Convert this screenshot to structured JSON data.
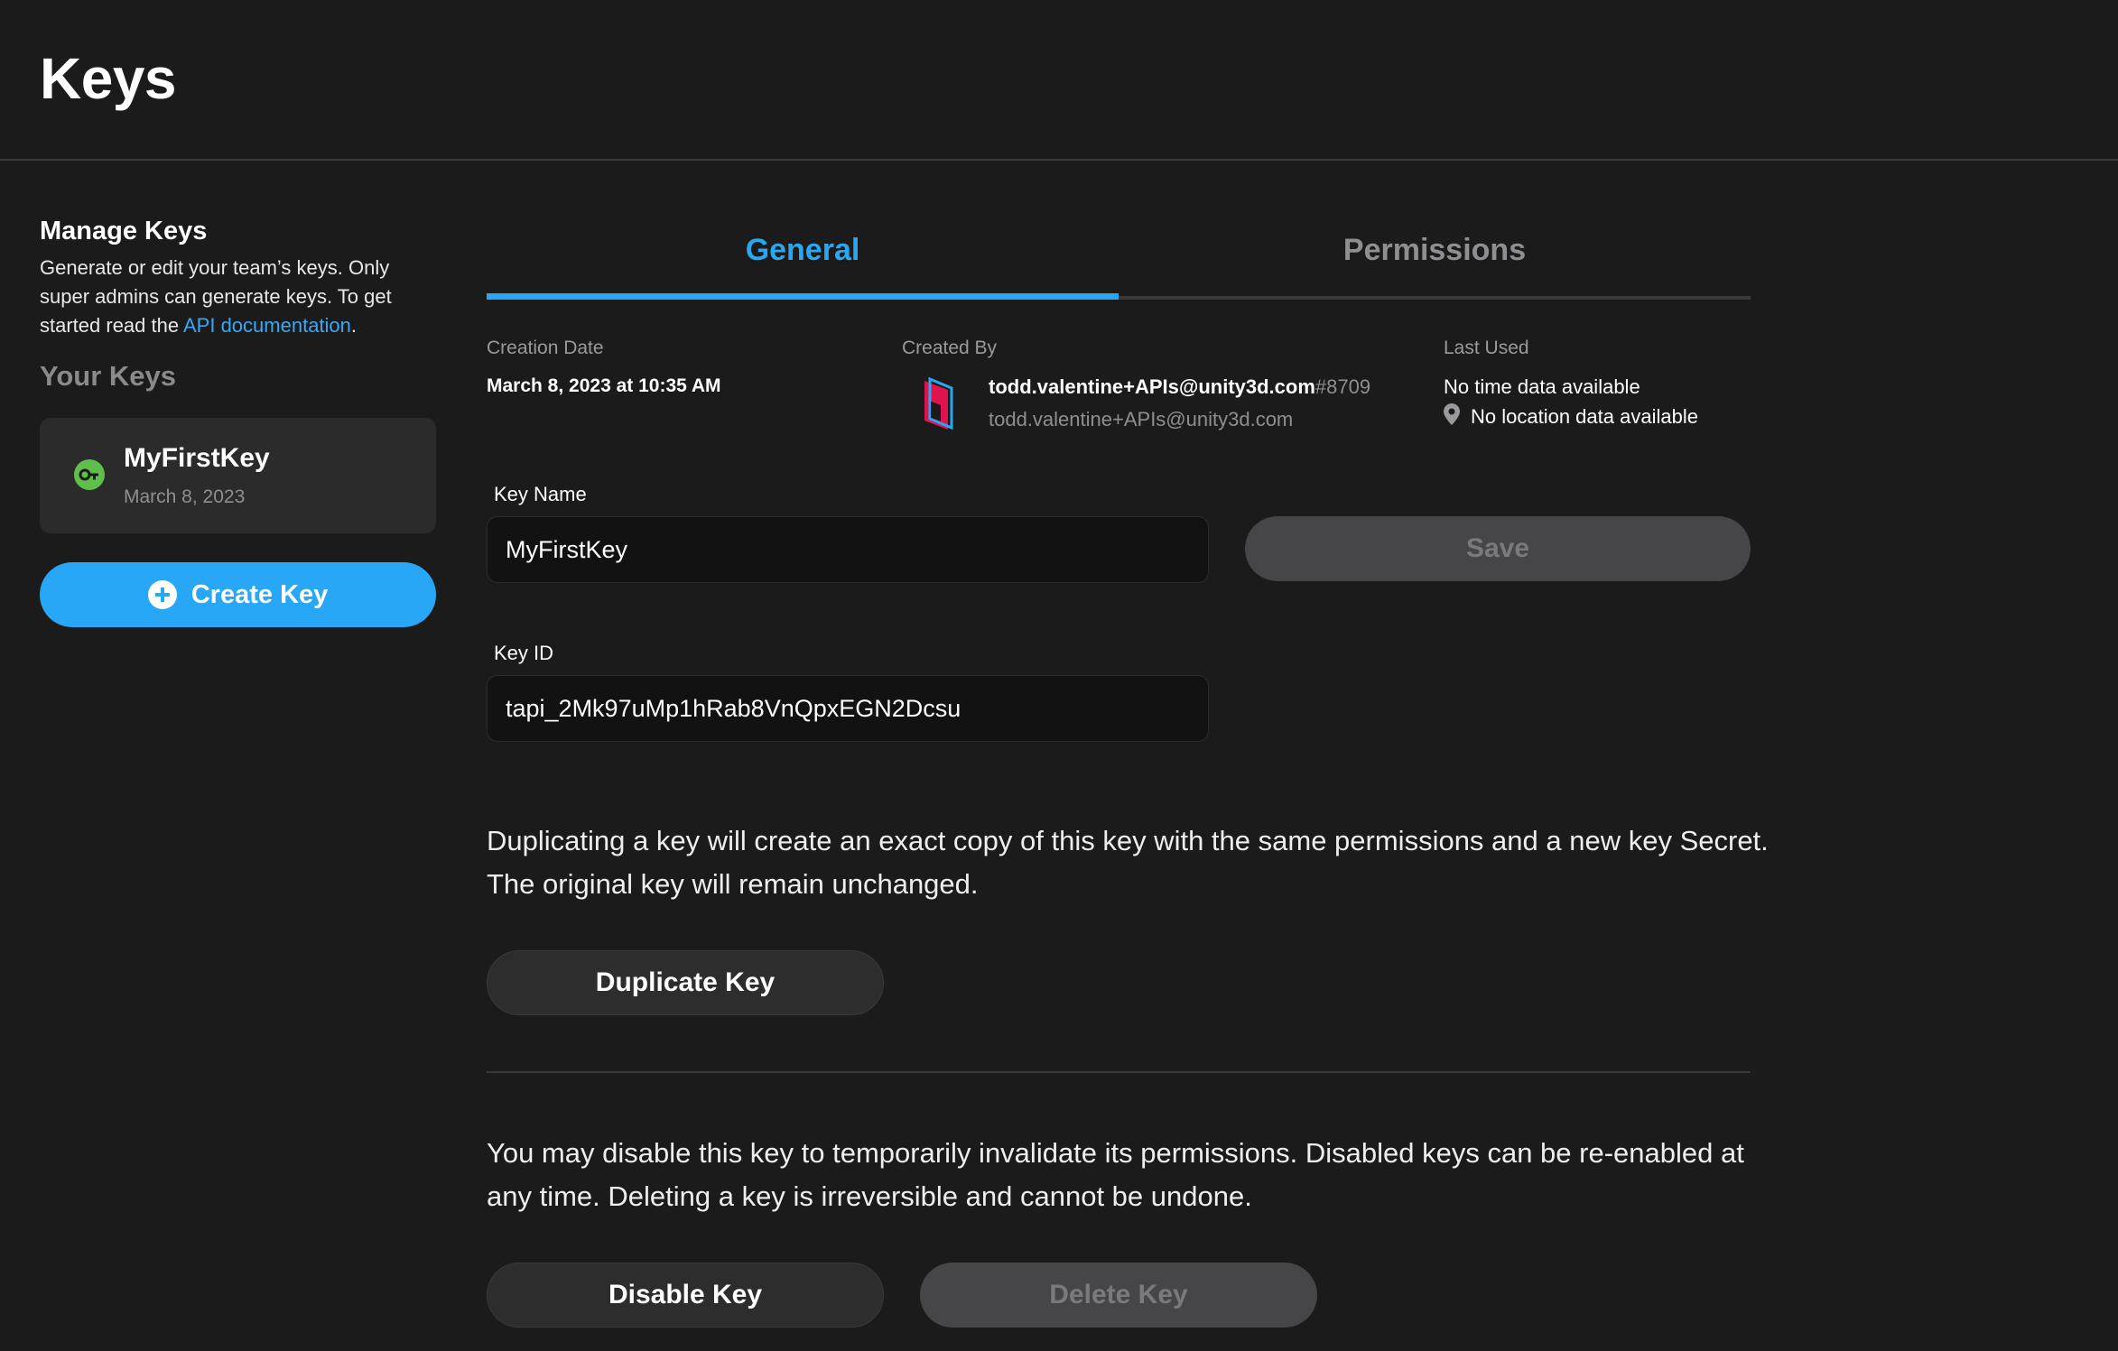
{
  "page": {
    "title": "Keys"
  },
  "sidebar": {
    "manage_title": "Manage Keys",
    "manage_desc_prefix": "Generate or edit your team’s keys. Only super admins can generate keys. To get started read the ",
    "manage_desc_link": "API documentation",
    "manage_desc_suffix": ".",
    "your_keys": "Your Keys",
    "keys": [
      {
        "name": "MyFirstKey",
        "date": "March 8, 2023",
        "status_color": "#5fbf4a",
        "icon": "key-icon"
      }
    ],
    "create_label": "Create Key"
  },
  "tabs": [
    {
      "label": "General",
      "active": true
    },
    {
      "label": "Permissions",
      "active": false
    }
  ],
  "meta": {
    "creation_label": "Creation Date",
    "creation_value": "March 8, 2023 at 10:35 AM",
    "created_by_label": "Created By",
    "creator_name": "todd.valentine+APIs@unity3d.com",
    "creator_tag": "#8709",
    "creator_email": "todd.valentine+APIs@unity3d.com",
    "last_used_label": "Last Used",
    "last_time": "No time data available",
    "last_location": "No location data available"
  },
  "form": {
    "key_name_label": "Key Name",
    "key_name_value": "MyFirstKey",
    "save_label": "Save",
    "key_id_label": "Key ID",
    "key_id_value": "tapi_2Mk97uMp1hRab8VnQpxEGN2Dcsu"
  },
  "duplicate": {
    "text": "Duplicating a key will create an exact copy of this key with the same permissions and a new key Secret. The original key will remain unchanged.",
    "button": "Duplicate Key"
  },
  "danger": {
    "text": "You may disable this key to temporarily invalidate its permissions. Disabled keys can be re-enabled at any time. Deleting a key is irreversible and cannot be undone.",
    "disable_button": "Disable Key",
    "delete_button": "Delete Key"
  },
  "colors": {
    "accent": "#28a7f6",
    "background": "#1b1b1c",
    "card": "#2b2b2c"
  }
}
